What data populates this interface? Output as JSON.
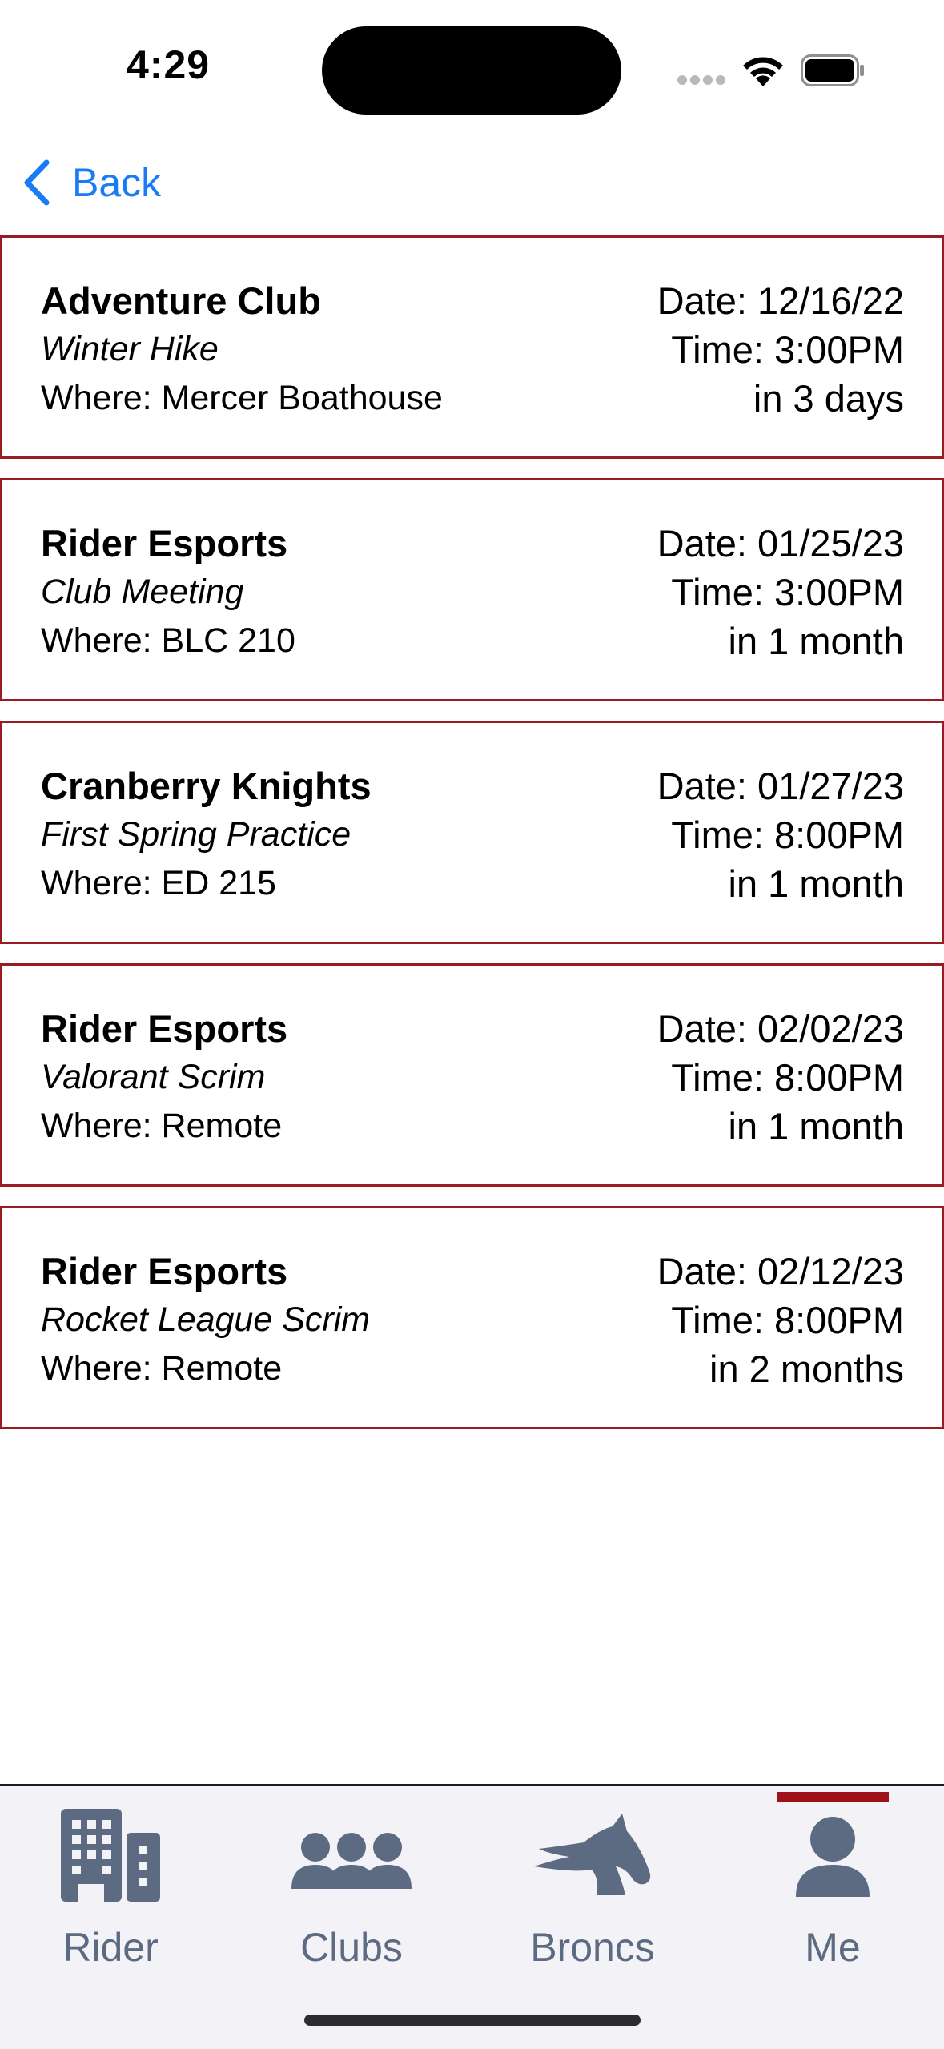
{
  "status_bar": {
    "time": "4:29"
  },
  "nav": {
    "back_label": "Back"
  },
  "events": [
    {
      "club": "Adventure Club",
      "event": "Winter Hike",
      "where": "Where: Mercer Boathouse",
      "date": "Date: 12/16/22",
      "time": "Time: 3:00PM",
      "relative": "in 3 days"
    },
    {
      "club": "Rider Esports",
      "event": "Club Meeting",
      "where": "Where: BLC 210",
      "date": "Date: 01/25/23",
      "time": "Time: 3:00PM",
      "relative": "in 1 month"
    },
    {
      "club": "Cranberry Knights",
      "event": "First Spring Practice",
      "where": "Where: ED 215",
      "date": "Date: 01/27/23",
      "time": "Time: 8:00PM",
      "relative": "in 1 month"
    },
    {
      "club": "Rider Esports",
      "event": "Valorant Scrim",
      "where": "Where: Remote",
      "date": "Date: 02/02/23",
      "time": "Time: 8:00PM",
      "relative": "in 1 month"
    },
    {
      "club": "Rider Esports",
      "event": "Rocket League Scrim",
      "where": "Where: Remote",
      "date": "Date: 02/12/23",
      "time": "Time: 8:00PM",
      "relative": "in 2 months"
    }
  ],
  "tabs": [
    {
      "label": "Rider",
      "icon": "building-icon"
    },
    {
      "label": "Clubs",
      "icon": "group-icon"
    },
    {
      "label": "Broncs",
      "icon": "horse-icon"
    },
    {
      "label": "Me",
      "icon": "person-icon",
      "active": true
    }
  ],
  "colors": {
    "accent": "#1a7cf5",
    "card_border": "#9b1b22",
    "tab_icon": "#5c6b82",
    "active_indicator": "#a0121a"
  }
}
